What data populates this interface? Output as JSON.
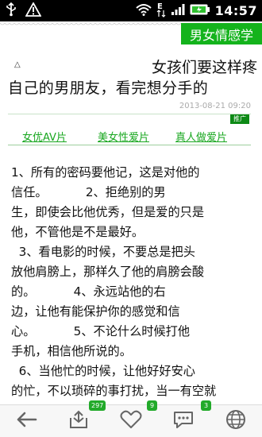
{
  "status_bar": {
    "time": "14:57",
    "icons": [
      "usb-icon",
      "warning-icon",
      "wifi-icon",
      "edge-data-icon",
      "signal-icon",
      "battery-icon"
    ]
  },
  "header": {
    "category": "男女情感学"
  },
  "article": {
    "title_line1": "女孩们要这样疼",
    "title_line2": "自己的男朋友，看完想分手的",
    "date": "2013-08-21 09:20"
  },
  "ads": {
    "label": "推广",
    "links": [
      "女优AV片",
      "美女性爱片",
      "真人做爱片"
    ]
  },
  "body": {
    "lines": [
      "1、所有的密码要他记，这是对他的",
      "信任。          2、拒绝别的男",
      "生，即使会比他优秀，但是爱的只是",
      "他，不管他是不是最好。",
      "  3、看电影的时候，不要总是把头",
      "放他肩膀上，那样久了他的肩膀会酸",
      "的。          4、永远站他的右",
      "边，让他有能保护你的感觉和信",
      "心。          5、不论什么时候打他",
      "手机，相信他所说的。",
      "  6、当他忙的时候，让他好好安心",
      "的忙，不以琐碎的事打扰，当一有空就"
    ]
  },
  "toolbar": {
    "items": [
      {
        "icon": "back-arrow-icon",
        "badge": ""
      },
      {
        "icon": "share-up-icon",
        "badge": "297"
      },
      {
        "icon": "heart-icon",
        "badge": "9"
      },
      {
        "icon": "comment-icon",
        "badge": "3"
      },
      {
        "icon": "globe-icon",
        "badge": ""
      }
    ]
  },
  "colors": {
    "accent_green": "#14b31c",
    "link_green": "#18a71f",
    "badge_green": "#22aa2a"
  }
}
